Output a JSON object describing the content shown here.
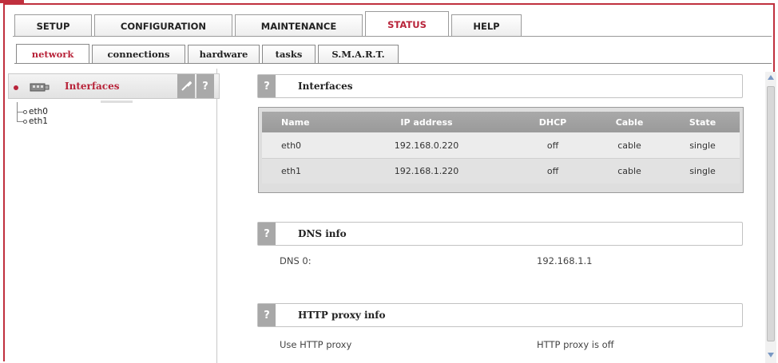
{
  "main_tabs": [
    {
      "label": "SETUP",
      "active": false
    },
    {
      "label": "CONFIGURATION",
      "active": false
    },
    {
      "label": "MAINTENANCE",
      "active": false
    },
    {
      "label": "STATUS",
      "active": true
    },
    {
      "label": "HELP",
      "active": false
    }
  ],
  "sub_tabs": [
    {
      "label": "network",
      "active": true
    },
    {
      "label": "connections",
      "active": false
    },
    {
      "label": "hardware",
      "active": false
    },
    {
      "label": "tasks",
      "active": false
    },
    {
      "label": "S.M.A.R.T.",
      "active": false
    }
  ],
  "sidebar": {
    "title": "Interfaces",
    "icon": "network-card-icon",
    "tool_icon": "wrench-icon",
    "help_label": "?",
    "tree": [
      "eth0",
      "eth1"
    ]
  },
  "interfaces_section": {
    "help_label": "?",
    "title": "Interfaces",
    "columns": [
      "Name",
      "IP address",
      "DHCP",
      "Cable",
      "State"
    ],
    "rows": [
      [
        "eth0",
        "192.168.0.220",
        "off",
        "cable",
        "single"
      ],
      [
        "eth1",
        "192.168.1.220",
        "off",
        "cable",
        "single"
      ]
    ]
  },
  "dns_section": {
    "help_label": "?",
    "title": "DNS info",
    "key": "DNS 0:",
    "value": "192.168.1.1"
  },
  "proxy_section": {
    "help_label": "?",
    "title": "HTTP proxy info",
    "key": "Use HTTP proxy",
    "value": "HTTP proxy is off"
  },
  "colors": {
    "accent": "#b8243a",
    "frame": "#c0303e",
    "header_gray": "#a8a8a8"
  }
}
